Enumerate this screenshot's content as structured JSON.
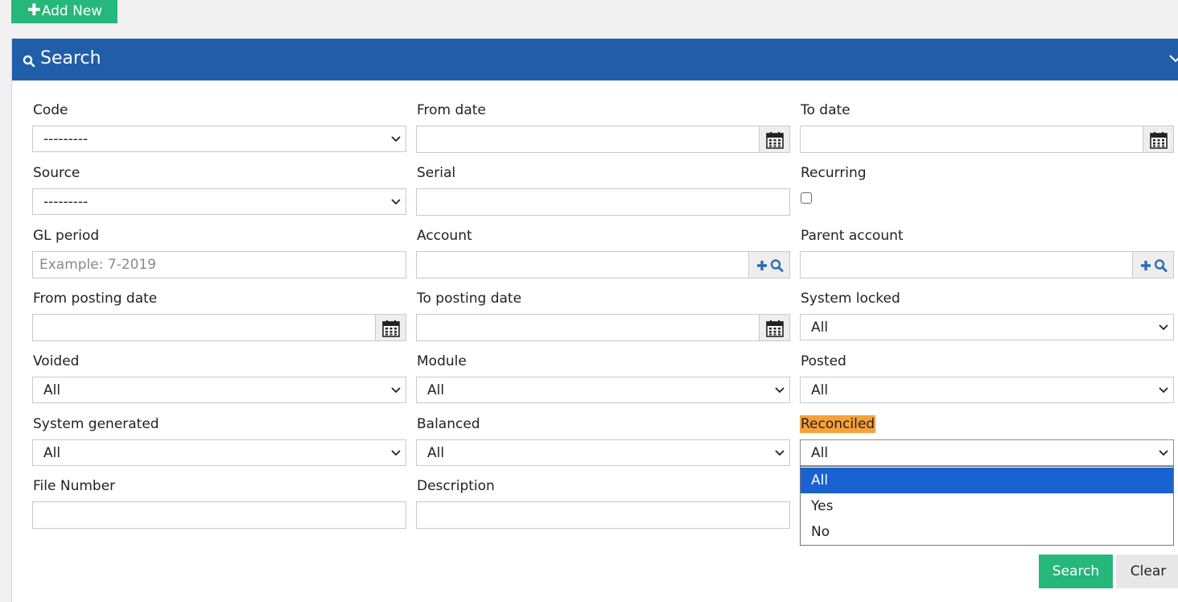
{
  "toolbar": {
    "add_new_label": "Add New"
  },
  "panel": {
    "title": "Search"
  },
  "fields": {
    "code": {
      "label": "Code",
      "value": "---------"
    },
    "from_date": {
      "label": "From date",
      "value": ""
    },
    "to_date": {
      "label": "To date",
      "value": ""
    },
    "source": {
      "label": "Source",
      "value": "---------"
    },
    "serial": {
      "label": "Serial",
      "value": ""
    },
    "recurring": {
      "label": "Recurring",
      "checked": false
    },
    "gl_period": {
      "label": "GL period",
      "placeholder": "Example: 7-2019",
      "value": ""
    },
    "account": {
      "label": "Account",
      "value": ""
    },
    "parent_account": {
      "label": "Parent account",
      "value": ""
    },
    "from_posting_date": {
      "label": "From posting date",
      "value": ""
    },
    "to_posting_date": {
      "label": "To posting date",
      "value": ""
    },
    "system_locked": {
      "label": "System locked",
      "value": "All"
    },
    "voided": {
      "label": "Voided",
      "value": "All"
    },
    "module": {
      "label": "Module",
      "value": "All"
    },
    "posted": {
      "label": "Posted",
      "value": "All"
    },
    "system_generated": {
      "label": "System generated",
      "value": "All"
    },
    "balanced": {
      "label": "Balanced",
      "value": "All"
    },
    "reconciled": {
      "label": "Reconciled",
      "value": "All",
      "options": [
        "All",
        "Yes",
        "No"
      ],
      "open": true,
      "highlighted_option": "All"
    },
    "file_number": {
      "label": "File Number",
      "value": ""
    },
    "description": {
      "label": "Description",
      "value": ""
    }
  },
  "actions": {
    "search_label": "Search",
    "clear_label": "Clear"
  },
  "colors": {
    "primary_blue": "#215ea9",
    "success_green": "#26b77a",
    "option_highlight": "#1a62d2",
    "label_highlight": "#f7a13a"
  },
  "icons": [
    "plus-icon",
    "search-icon",
    "chevron-down-icon",
    "calendar-icon",
    "lookup-add-icon",
    "lookup-search-icon"
  ]
}
